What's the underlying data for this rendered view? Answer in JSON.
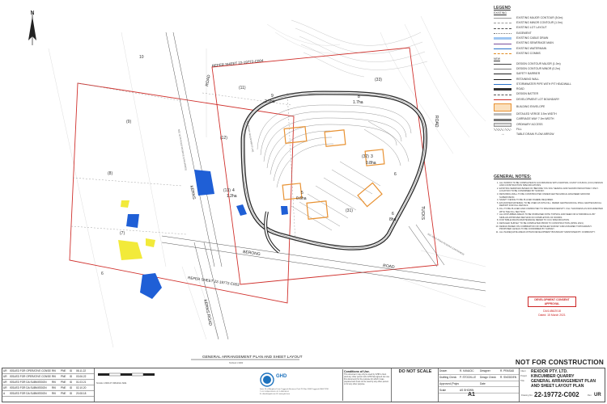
{
  "north": {
    "label": "N"
  },
  "lots": {
    "lot10": "10",
    "lot9": "(9)",
    "lot8": "(8)",
    "lot7": "(7)",
    "lot6": "6",
    "lot11": "(11)",
    "lot12": "(12)",
    "lot13": "(13)",
    "lot31": "(31)",
    "lot32": "(32)",
    "lot33": "(33)",
    "lot6b": "6",
    "area_9": "9",
    "area_9_ha": "2.7ha",
    "area_8": "8",
    "area_8_ha": "1.7ha",
    "area_4": "4",
    "area_4_ha": "1.2ha",
    "area_5": "5",
    "area_5_ha": "0.6ha",
    "area_3": "3",
    "area_3_ha": "0.8ha",
    "area_6": "6",
    "area_6_ha": "8ha"
  },
  "roads": {
    "road_top": "ROAD",
    "road_bottom": "ROAD",
    "kerns_road": "KERNS",
    "kerns_road_bottom": "KERNS ROAD",
    "berong": "BERONG",
    "tucks": "TUCKS",
    "road_right": "ROAD",
    "unnamed_left": "SEE NOTE ROAD RESERVE (UNFORMED)",
    "unnamed_center": "BOUNDARY ADJUSTMENT LINE",
    "unnamed_right": "SEE NOTE ROAD RESERVE (UNFORMED)"
  },
  "refs": {
    "top": "REFER SHEET 22-19772-C004",
    "bottom": "REFER SHEET 22-19772-C003"
  },
  "plan_title": "GENERAL ARRANGEMENT PLAN AND SHEET LAYOUT",
  "plan_scale": "SCALE 1:3000",
  "legend": {
    "title": "LEGEND",
    "existing_heading": "EXISTING",
    "existing": [
      "EXISTING MAJOR CONTOUR (5.0m)",
      "EXISTING MINOR CONTOUR (1.0m)",
      "EXISTING LOT LAYOUT",
      "EASEMENT",
      "EXISTING CABLE DRAIN",
      "EXISTING SEWERAGE MAIN",
      "EXISTING WATERMAIN",
      "EXISTING COMMS"
    ],
    "new_heading": "NEW",
    "new_items": [
      "DESIGN CONTOUR MAJOR (1.0m)",
      "DESIGN CONTOUR MINOR (0.2m)",
      "SAFETY BARRIER",
      "RETAINING WALL",
      "STORMWATER PIPE WITH PIT HEADWALL",
      "ROAD",
      "DESIGN BATTER",
      "DEVELOPMENT LOT BOUNDARY",
      "BUILDING ENVELOPE",
      "DETAILED VERGE 3.5m WIDTH",
      "CARRIAGE WAY 7.0m WIDTH",
      "ORDINARY ACCESS",
      "FILL",
      "TABLE DRAIN FLOW ARROW"
    ]
  },
  "notes": {
    "title": "GENERAL NOTES:",
    "items": [
      "ALL WORKS TO BE COMPLETED IN ACCORDANCE WITH CENTRAL COAST COUNCIL (CCC) DESIGN AND CONSTRUCTION SPECIFICATIONS.",
      "EXISTING SERVICES BASED ON 'BEFORE YOU DIG' SEARCH AND SHOWN INDICATIVELY ONLY. LOCATION TO BE CONFIRMED BY SURVEY.",
      "RETAINING WALL TO BE CONSTRUCTED UNDER GEOTECHNICAL ENGINEER GROUND SUPERVISION.",
      "SAFETY FENCE TO BE PLACED WHERE REQUIRED.",
      "EXCAVATED MATERIAL TO BE USED AS SITE FILL. REFER GEOTECHNICAL FINAL GEOTECHNICAL REPORT FOR FILL DETAILS.",
      "FILL TO BE PLACED AND COMPACTED TO SPECIFIED DENSITY. FILL THICKNESS AS DOCUMENTED WITH THE FILL SECTION.",
      "ALL DISTURBED AREAS TO BE STABILISED WITH TOPSOIL AND SEED OR HYDROMULCH BY SIMILAR APPROVED METHOD ON COMPLETION OF WORKS.",
      "FOR TABLE DRAIN MAINTENANCE REFER TO CCC SPECIFICATION.",
      "DETAILED SURVEY TO BE COMPLETED PRIOR TO CONSTRUCTION (APRIL 2021).",
      "DESIGN BASED ON COMBINATION OF DETAILED SURVEY AND ASSUMED TOPOGRAPHY. PROPOSED LEVELS TO BE CONFIRMED BY SURVEY.",
      "ALL INADEQUATE AREAS WITHIN DEVELOPMENT BOUNDARY MAINTAINED BY COMMUNITY."
    ]
  },
  "stamp": {
    "title": "DEVELOPMENT CONSENT APPROVAL",
    "ref": "DA/1486/2018",
    "date": "Dated: 15 March 2021"
  },
  "not_for_construction": "NOT FOR CONSTRUCTION",
  "revisions": [
    {
      "rev": "UR",
      "desc": "ISSUED FOR OPERATIVE CONSENT",
      "by": "RKI",
      "chk": "PNE",
      "app": "ID",
      "date": "08.11.22"
    },
    {
      "rev": "UR",
      "desc": "ISSUED FOR OPERATIVE CONSENT",
      "by": "RKI",
      "chk": "PNE",
      "app": "ID",
      "date": "03.06.22"
    },
    {
      "rev": "UR",
      "desc": "ISSUED FOR DA SUBMISSION",
      "by": "RKI",
      "chk": "PNE",
      "app": "ID",
      "date": "01.03.21"
    },
    {
      "rev": "UR",
      "desc": "ISSUED FOR DA SUBMISSION",
      "by": "RKI",
      "chk": "PNE",
      "app": "ID",
      "date": "02.10.20"
    },
    {
      "rev": "A",
      "desc": "ISSUED FOR DA SUBMISSION",
      "by": "RKI",
      "chk": "PNE",
      "app": "ID",
      "date": "20.08.18"
    }
  ],
  "scale_bar": {
    "label": "SCALE 1:3000 AT ORIGINAL SIZE"
  },
  "firm": {
    "name": "GHD",
    "address": "Suite 10 of Marpkeis Drive Tuggerah Business Park PO Box 3008 Tuggerah NSW 2259",
    "phone": "T: 61 2 4350 4100  F: 61 2 4350 4101",
    "email": "E: ntlmail@ghd.com  W: www.ghd.com"
  },
  "conditions": {
    "heading": "Conditions of Use.",
    "body": "This document may only be used by GHD's client (and any other person who GHD has agreed can use this document) for the purpose for which it was prepared and must not be used by any other person or for any other purpose."
  },
  "do_not_scale": "DO NOT SCALE",
  "people": {
    "drawn_label": "Drawn",
    "drawn": "R. KAVACIC",
    "designer_label": "Designer",
    "designer": "R. PRASAD",
    "drafting_label": "Drafting Check",
    "drafting": "P. STOCKLLE",
    "design_label": "Design Check",
    "design": "R. SNODDEN",
    "approved_label": "Approved (Project Director)",
    "approved": "",
    "date_label": "Date",
    "date": "",
    "scale_label": "Scale",
    "scale": "AS SHOWN"
  },
  "project": {
    "client_label": "Client",
    "client": "REXDOR PTY. LTD.",
    "project_label": "Project",
    "project": "KINCUMBER QUARRY",
    "title_label": "Title",
    "title1": "GENERAL ARRANGEMENT PLAN",
    "title2": "AND SHEET LAYOUT PLAN",
    "size": "A1",
    "drawing_label": "Drawing No:",
    "drawing_no": "22-19772-C002",
    "rev_label": "Rev:",
    "rev": "UR"
  },
  "colors": {
    "boundary_red": "#d0312d",
    "building_orange": "#e89233",
    "pond_blue": "#1f5fd6",
    "yellow": "#f2ea3a",
    "road_dark": "#2a2a2a"
  }
}
